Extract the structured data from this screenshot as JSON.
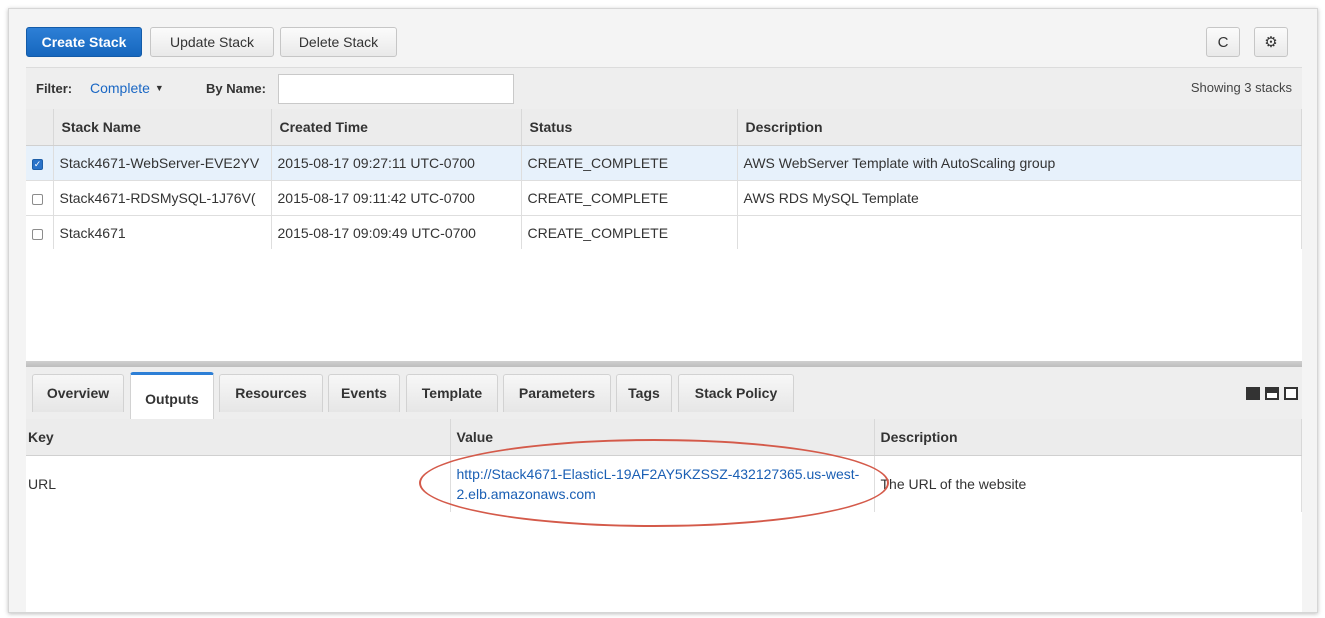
{
  "toolbar": {
    "create_stack": "Create Stack",
    "update_stack": "Update Stack",
    "delete_stack": "Delete Stack",
    "refresh_icon": "C",
    "settings_icon": "⚙"
  },
  "filter": {
    "label": "Filter:",
    "value": "Complete",
    "by_name_label": "By Name:",
    "by_name_value": "",
    "showing": "Showing 3 stacks"
  },
  "stacks": {
    "headers": [
      "Stack Name",
      "Created Time",
      "Status",
      "Description"
    ],
    "rows": [
      {
        "name": "Stack4671-WebServer-EVE2YV",
        "created": "2015-08-17 09:27:11 UTC-0700",
        "status": "CREATE_COMPLETE",
        "description": "AWS WebServer Template with AutoScaling group",
        "selected": true
      },
      {
        "name": "Stack4671-RDSMySQL-1J76V(",
        "created": "2015-08-17 09:11:42 UTC-0700",
        "status": "CREATE_COMPLETE",
        "description": "AWS RDS MySQL Template",
        "selected": false
      },
      {
        "name": "Stack4671",
        "created": "2015-08-17 09:09:49 UTC-0700",
        "status": "CREATE_COMPLETE",
        "description": "",
        "selected": false
      }
    ]
  },
  "tabs": [
    "Overview",
    "Outputs",
    "Resources",
    "Events",
    "Template",
    "Parameters",
    "Tags",
    "Stack Policy"
  ],
  "active_tab": "Outputs",
  "outputs": {
    "headers": [
      "Key",
      "Value",
      "Description"
    ],
    "rows": [
      {
        "key": "URL",
        "value": "http://Stack4671-ElasticL-19AF2AY5KZSSZ-432127365.us-west-2.elb.amazonaws.com",
        "description": "The URL of the website"
      }
    ]
  },
  "colors": {
    "primary": "#1667be",
    "status_green": "#2e8b1a",
    "link_blue": "#1a5fb4",
    "highlight_red": "#d45a4a"
  }
}
